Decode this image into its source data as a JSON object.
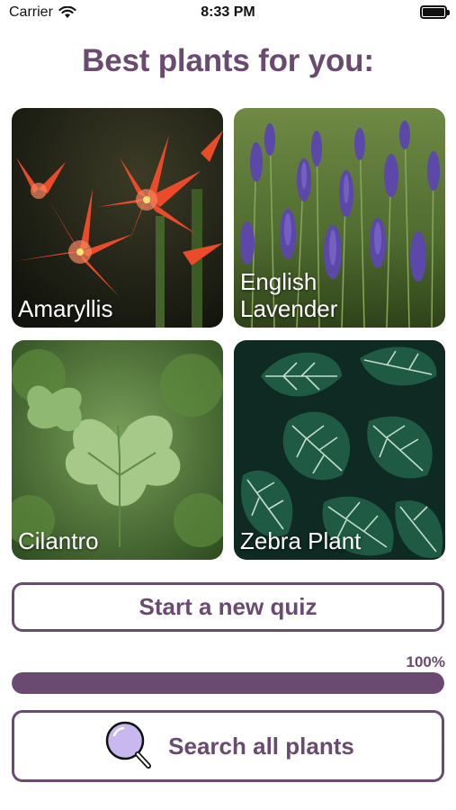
{
  "status_bar": {
    "carrier": "Carrier",
    "time": "8:33 PM",
    "wifi_icon": "wifi-icon",
    "battery_icon": "battery-icon"
  },
  "header": {
    "title": "Best plants for you:"
  },
  "plants": [
    {
      "name": "Amaryllis",
      "icon": "amaryllis-photo"
    },
    {
      "name": "English\nLavender",
      "icon": "lavender-photo"
    },
    {
      "name": "Cilantro",
      "icon": "cilantro-photo"
    },
    {
      "name": "Zebra Plant",
      "icon": "zebra-plant-photo"
    }
  ],
  "actions": {
    "new_quiz_label": "Start a new quiz",
    "search_label": "Search all plants",
    "search_icon": "magnifying-glass-icon"
  },
  "progress": {
    "label": "100%",
    "value": 1.0
  },
  "colors": {
    "accent": "#6a4a70",
    "progress_track": "#e6dde8",
    "search_lens": "#c9b8f0"
  }
}
